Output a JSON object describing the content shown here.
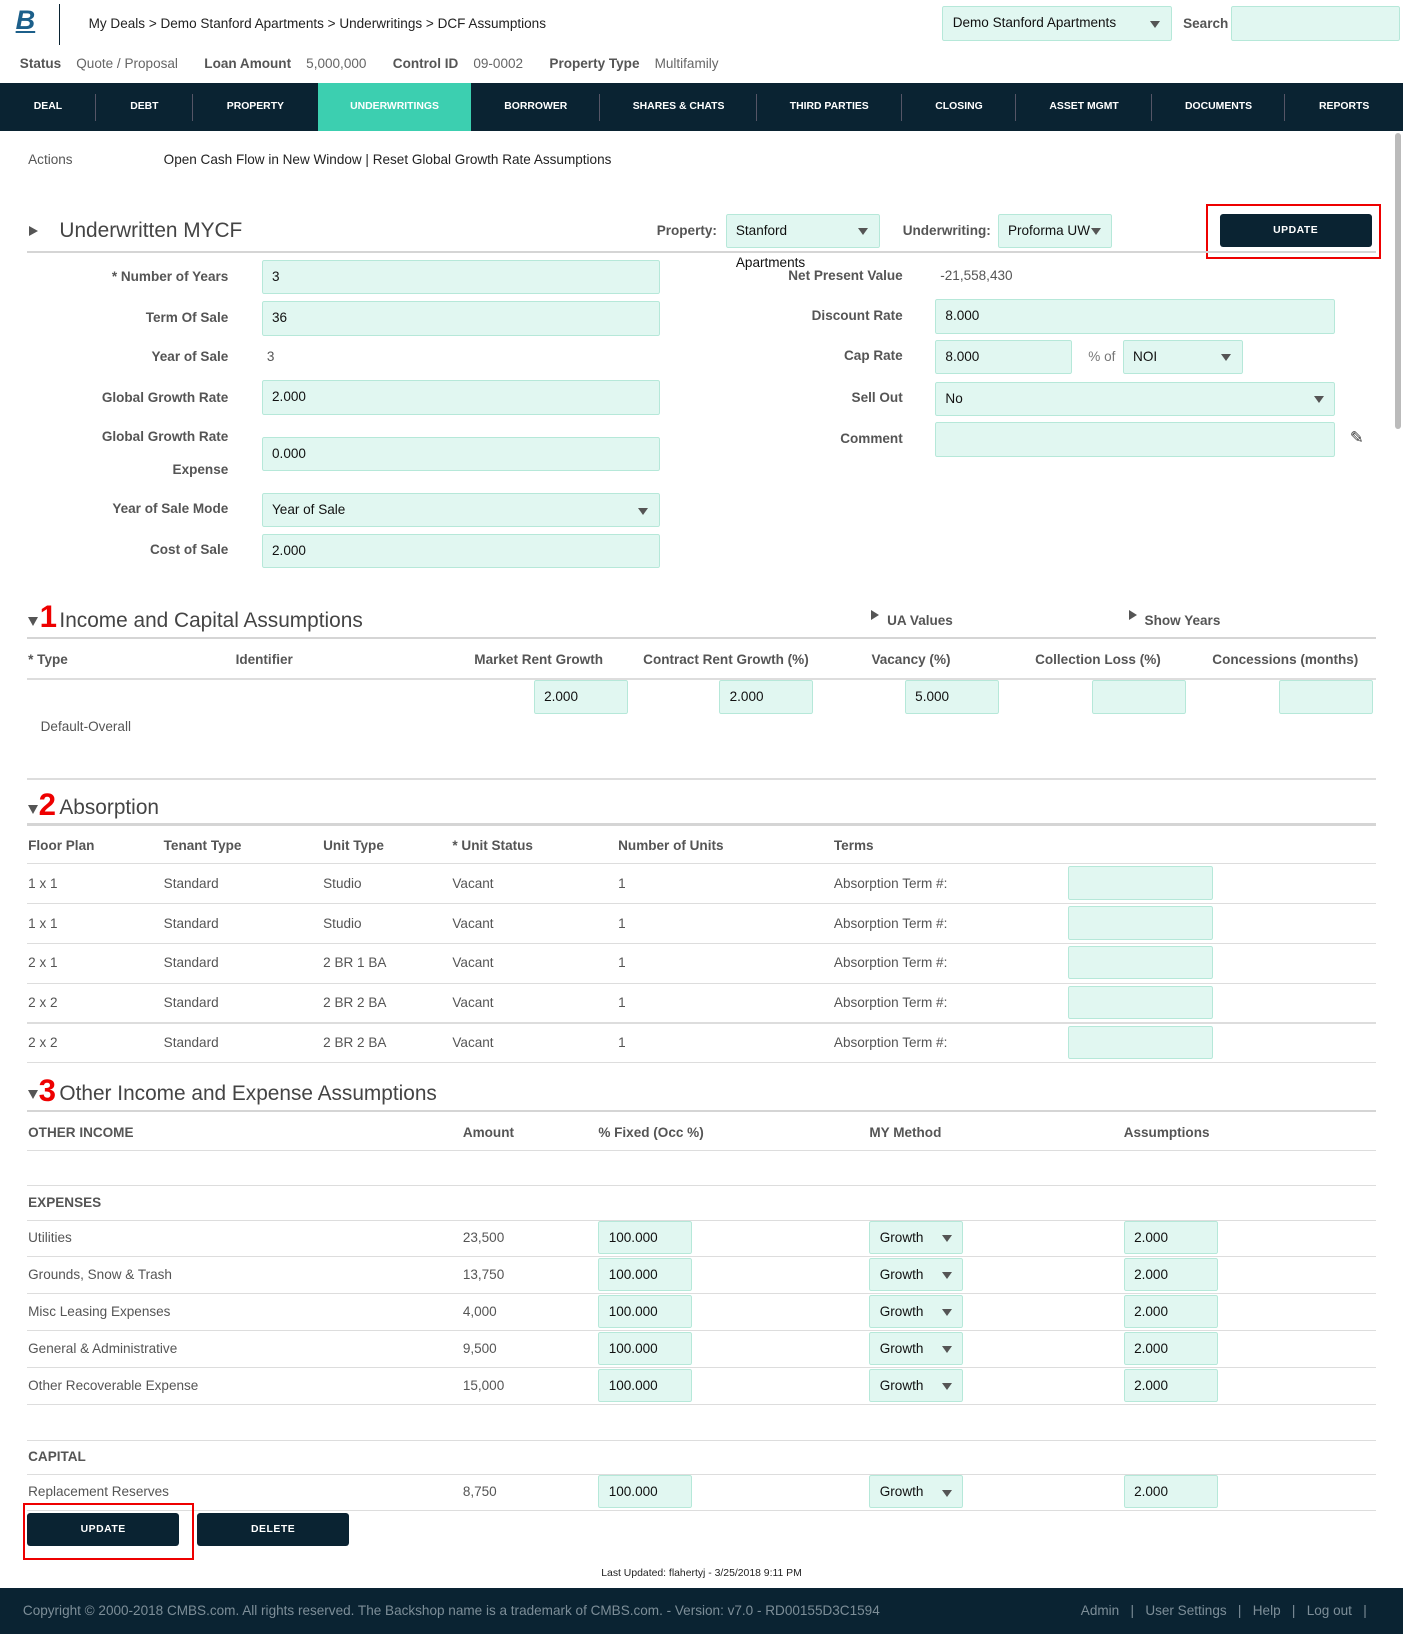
{
  "header": {
    "logo": "B",
    "breadcrumb": "My Deals > Demo Stanford Apartments > Underwritings > DCF Assumptions",
    "deal_select": "Demo Stanford Apartments",
    "search_label": "Search",
    "search_value": ""
  },
  "summary": {
    "status_label": "Status",
    "status": "Quote / Proposal",
    "loan_label": "Loan Amount",
    "loan": "5,000,000",
    "control_label": "Control ID",
    "control": "09-0002",
    "ptype_label": "Property Type",
    "ptype": "Multifamily"
  },
  "nav": [
    "DEAL",
    "DEBT",
    "PROPERTY",
    "UNDERWRITINGS",
    "BORROWER",
    "SHARES & CHATS",
    "THIRD PARTIES",
    "CLOSING",
    "ASSET MGMT",
    "DOCUMENTS",
    "REPORTS"
  ],
  "nav_active": "UNDERWRITINGS",
  "accent": "#3ccfb0",
  "nav_bg": "#0a2332",
  "actions": {
    "label": "Actions",
    "link1": "Open Cash Flow in New Window",
    "sep": " | ",
    "link2": "Reset Global Growth Rate Assumptions"
  },
  "mycf": {
    "title": "Underwritten MYCF",
    "property_label": "Property:",
    "property": "Stanford Apartments",
    "uw_label": "Underwriting:",
    "uw": "Proforma UW",
    "update": "UPDATE",
    "left": {
      "years_label": "* Number of Years",
      "years": "3",
      "term_label": "Term Of Sale",
      "term": "36",
      "yos_label": "Year of Sale",
      "yos": "3",
      "ggr_label": "Global Growth Rate",
      "ggr": "2.000",
      "ggre_label1": "Global Growth Rate",
      "ggre_label2": "Expense",
      "ggre": "0.000",
      "mode_label": "Year of Sale Mode",
      "mode": "Year of Sale",
      "cost_label": "Cost of Sale",
      "cost": "2.000"
    },
    "right": {
      "npv_label": "Net Present Value",
      "npv": "-21,558,430",
      "disc_label": "Discount Rate",
      "disc": "8.000",
      "cap_label": "Cap Rate",
      "cap": "8.000",
      "pct_of": "% of",
      "cap_basis": "NOI",
      "sell_label": "Sell Out",
      "sell": "No",
      "comment_label": "Comment",
      "comment": ""
    }
  },
  "income": {
    "num": "1",
    "title": "Income and Capital Assumptions",
    "ua": "UA Values",
    "show_years": "Show Years",
    "headers": [
      "* Type",
      "Identifier",
      "Market Rent Growth",
      "Contract Rent Growth (%)",
      "Vacancy (%)",
      "Collection Loss (%)",
      "Concessions (months)"
    ],
    "row": {
      "type": "Default-Overall",
      "market": "2.000",
      "contract": "2.000",
      "vacancy": "5.000",
      "collection": "",
      "concessions": ""
    }
  },
  "absorption": {
    "num": "2",
    "title": "Absorption",
    "headers": [
      "Floor Plan",
      "Tenant Type",
      "Unit Type",
      "* Unit Status",
      "Number of Units",
      "Terms"
    ],
    "rows": [
      [
        "1 x 1",
        "Standard",
        "Studio",
        "Vacant",
        "1",
        "Absorption Term #:",
        ""
      ],
      [
        "1 x 1",
        "Standard",
        "Studio",
        "Vacant",
        "1",
        "Absorption Term #:",
        ""
      ],
      [
        "2 x 1",
        "Standard",
        "2 BR 1 BA",
        "Vacant",
        "1",
        "Absorption Term #:",
        ""
      ],
      [
        "2 x 2",
        "Standard",
        "2 BR 2 BA",
        "Vacant",
        "1",
        "Absorption Term #:",
        ""
      ],
      [
        "2 x 2",
        "Standard",
        "2 BR 2 BA",
        "Vacant",
        "1",
        "Absorption Term #:",
        ""
      ]
    ]
  },
  "other": {
    "num": "3",
    "title": "Other Income and Expense Assumptions",
    "headers": [
      "OTHER INCOME",
      "Amount",
      "% Fixed (Occ %)",
      "MY Method",
      "Assumptions"
    ],
    "expenses_label": "EXPENSES",
    "expenses": [
      [
        "Utilities",
        "23,500",
        "100.000",
        "Growth",
        "2.000"
      ],
      [
        "Grounds, Snow & Trash",
        "13,750",
        "100.000",
        "Growth",
        "2.000"
      ],
      [
        "Misc Leasing Expenses",
        "4,000",
        "100.000",
        "Growth",
        "2.000"
      ],
      [
        "General & Administrative",
        "9,500",
        "100.000",
        "Growth",
        "2.000"
      ],
      [
        "Other Recoverable Expense",
        "15,000",
        "100.000",
        "Growth",
        "2.000"
      ]
    ],
    "capital_label": "CAPITAL",
    "capital": [
      [
        "Replacement Reserves",
        "8,750",
        "100.000",
        "Growth",
        "2.000"
      ]
    ]
  },
  "buttons": {
    "update": "UPDATE",
    "delete": "DELETE"
  },
  "last_updated": "Last Updated: flahertyj - 3/25/2018 9:11 PM",
  "footer": {
    "copyright": "Copyright © 2000-2018 CMBS.com. All rights reserved. The Backshop name is a trademark of CMBS.com. - Version: v7.0 - RD00155D3C1594",
    "links": [
      "Admin",
      "User Settings",
      "Help",
      "Log out"
    ]
  }
}
